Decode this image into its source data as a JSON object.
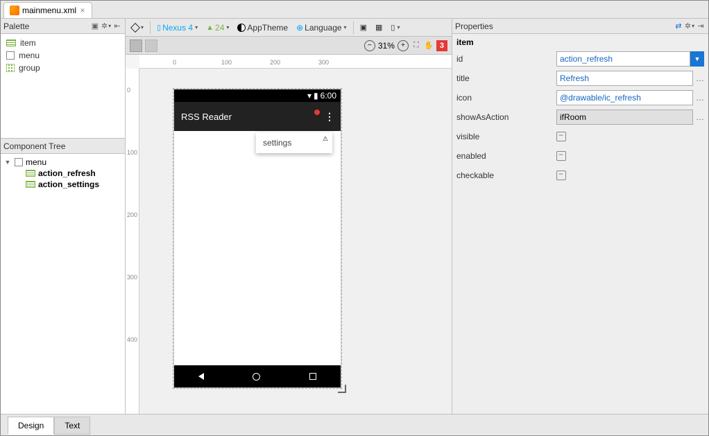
{
  "tab": {
    "filename": "mainmenu.xml"
  },
  "palette": {
    "title": "Palette",
    "items": [
      "item",
      "menu",
      "group"
    ]
  },
  "componentTree": {
    "title": "Component Tree",
    "root": "menu",
    "children": [
      "action_refresh",
      "action_settings"
    ]
  },
  "toolbar": {
    "device": "Nexus 4",
    "api": "24",
    "theme": "AppTheme",
    "language": "Language"
  },
  "canvas": {
    "zoom": "31%",
    "errors": "3",
    "ruler_h": [
      "0",
      "100",
      "200",
      "300"
    ],
    "ruler_v": [
      "0",
      "100",
      "200",
      "300",
      "400"
    ]
  },
  "device_preview": {
    "time": "6:00",
    "app_title": "RSS Reader",
    "menu_item": "settings"
  },
  "properties": {
    "title": "Properties",
    "type": "item",
    "rows": {
      "id": "action_refresh",
      "title": "Refresh",
      "icon": "@drawable/ic_refresh",
      "showAsAction": "ifRoom",
      "visible": "",
      "enabled": "",
      "checkable": ""
    },
    "labels": {
      "id": "id",
      "title": "title",
      "icon": "icon",
      "showAsAction": "showAsAction",
      "visible": "visible",
      "enabled": "enabled",
      "checkable": "checkable"
    }
  },
  "bottom_tabs": {
    "design": "Design",
    "text": "Text"
  }
}
